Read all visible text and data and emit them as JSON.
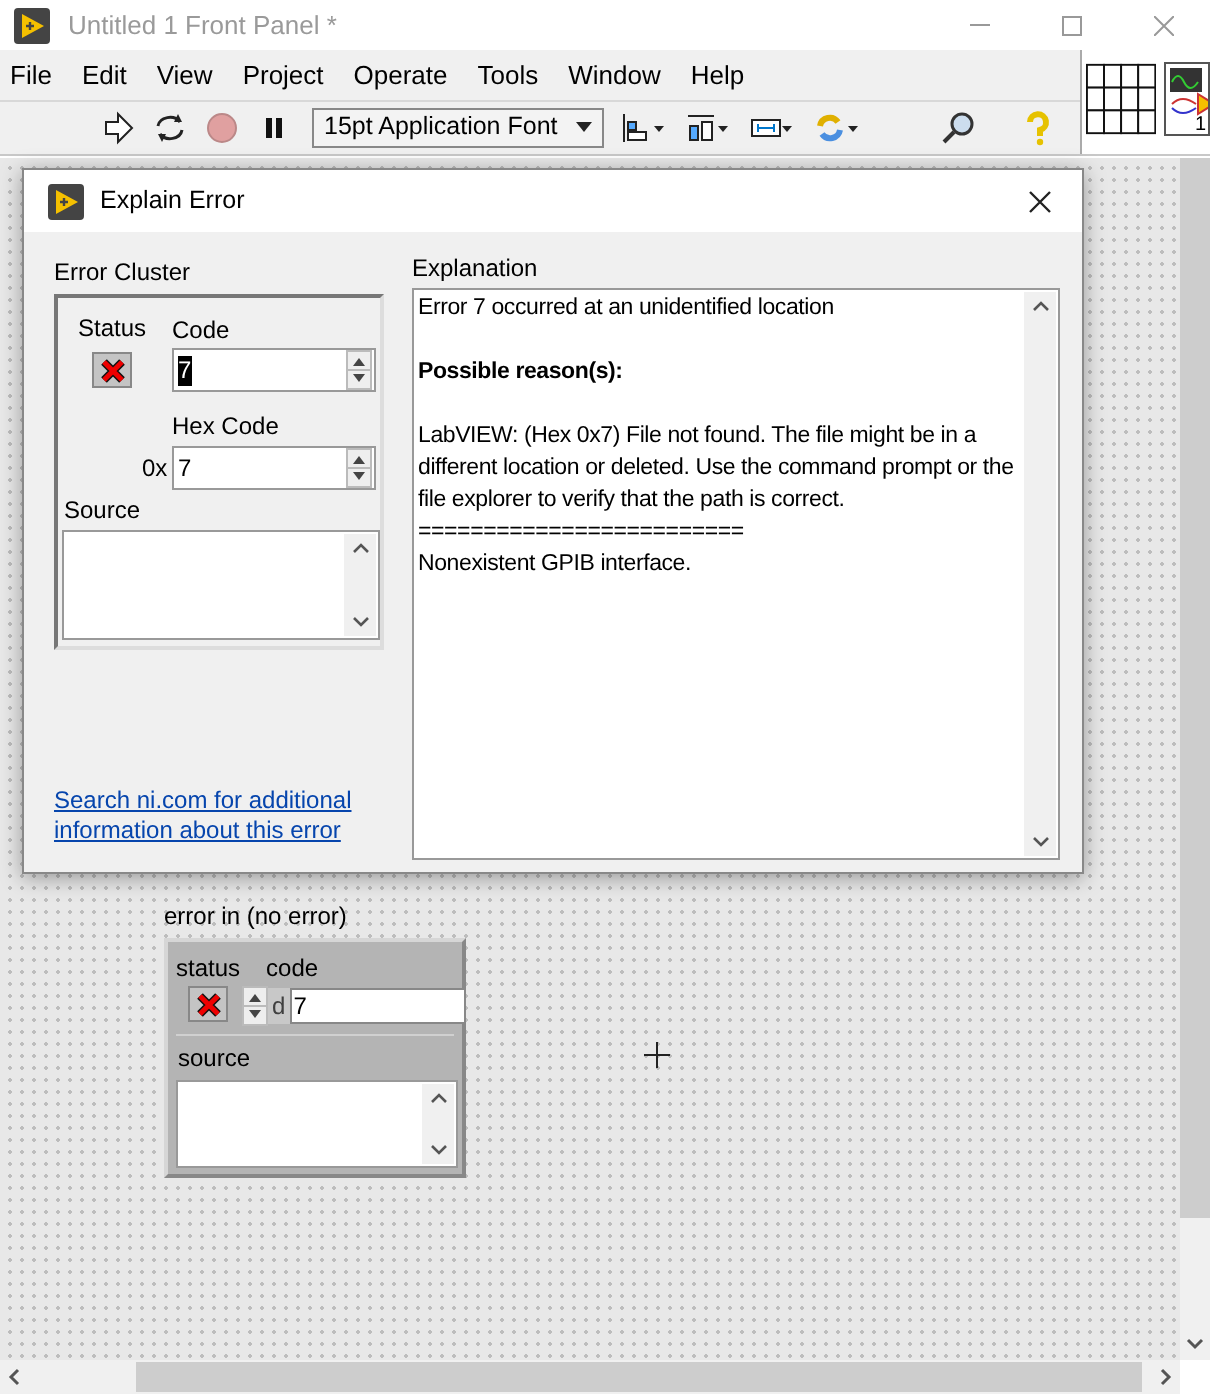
{
  "window": {
    "title": "Untitled 1 Front Panel *"
  },
  "menu": [
    "File",
    "Edit",
    "View",
    "Project",
    "Operate",
    "Tools",
    "Window",
    "Help"
  ],
  "toolbar": {
    "font": "15pt Application Font"
  },
  "vi_icon": {
    "number": "1"
  },
  "dialog": {
    "title": "Explain Error",
    "error_cluster": {
      "label": "Error Cluster",
      "status_label": "Status",
      "status_error": true,
      "code_label": "Code",
      "code": "7",
      "code_selected": true,
      "hex_label": "Hex Code",
      "hex_prefix": "0x",
      "hex_code": "7",
      "source_label": "Source"
    },
    "link": "Search ni.com for additional information about this error",
    "explanation": {
      "label": "Explanation",
      "paragraphs": [
        {
          "bold": false,
          "lines": [
            "Error 7 occurred at an unidentified location"
          ]
        },
        {
          "bold": true,
          "lines": [
            "Possible reason(s):"
          ]
        },
        {
          "bold": false,
          "lines": [
            "LabVIEW: (Hex 0x7) File not found. The file might be in a different location or deleted. Use the command prompt or the file explorer to verify that the path is correct.",
            "=========================",
            "Nonexistent GPIB interface."
          ]
        }
      ]
    }
  },
  "front_panel": {
    "label": "error in (no error)",
    "status_label": "status",
    "status_error": true,
    "code_label": "code",
    "radix": "d",
    "code": "7",
    "source_label": "source"
  }
}
